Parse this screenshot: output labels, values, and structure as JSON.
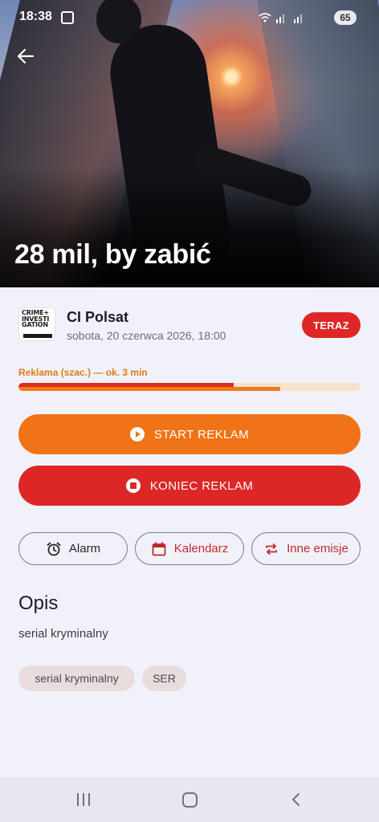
{
  "status_bar": {
    "time": "18:38",
    "battery": "65"
  },
  "hero": {
    "title": "28 mil, by zabić"
  },
  "channel": {
    "logo_text": [
      "CRIME+",
      "INVESTI",
      "GATION",
      "POLSAT"
    ],
    "name": "CI Polsat",
    "datetime": "sobota, 20 czerwca 2026, 18:00",
    "badge": "TERAZ"
  },
  "ad_progress": {
    "label": "Reklama (szac.) — ok. 3 min",
    "elapsed_fraction": 0.63,
    "buffer_fraction": 0.765
  },
  "actions": {
    "start_label": "START REKLAM",
    "end_label": "KONIEC REKLAM",
    "alarm_label": "Alarm",
    "calendar_label": "Kalendarz",
    "other_label": "Inne emisje"
  },
  "description": {
    "heading": "Opis",
    "text": "serial kryminalny"
  },
  "tags": [
    "serial kryminalny",
    "SER"
  ],
  "colors": {
    "orange": "#f07318",
    "red": "#dd2727",
    "background": "#f1f2f9"
  },
  "icons": {
    "back": "arrow-left-icon",
    "start": "play-circle-icon",
    "end": "stop-circle-icon",
    "alarm": "alarm-clock-icon",
    "calendar": "calendar-icon",
    "other": "repeat-icon"
  }
}
